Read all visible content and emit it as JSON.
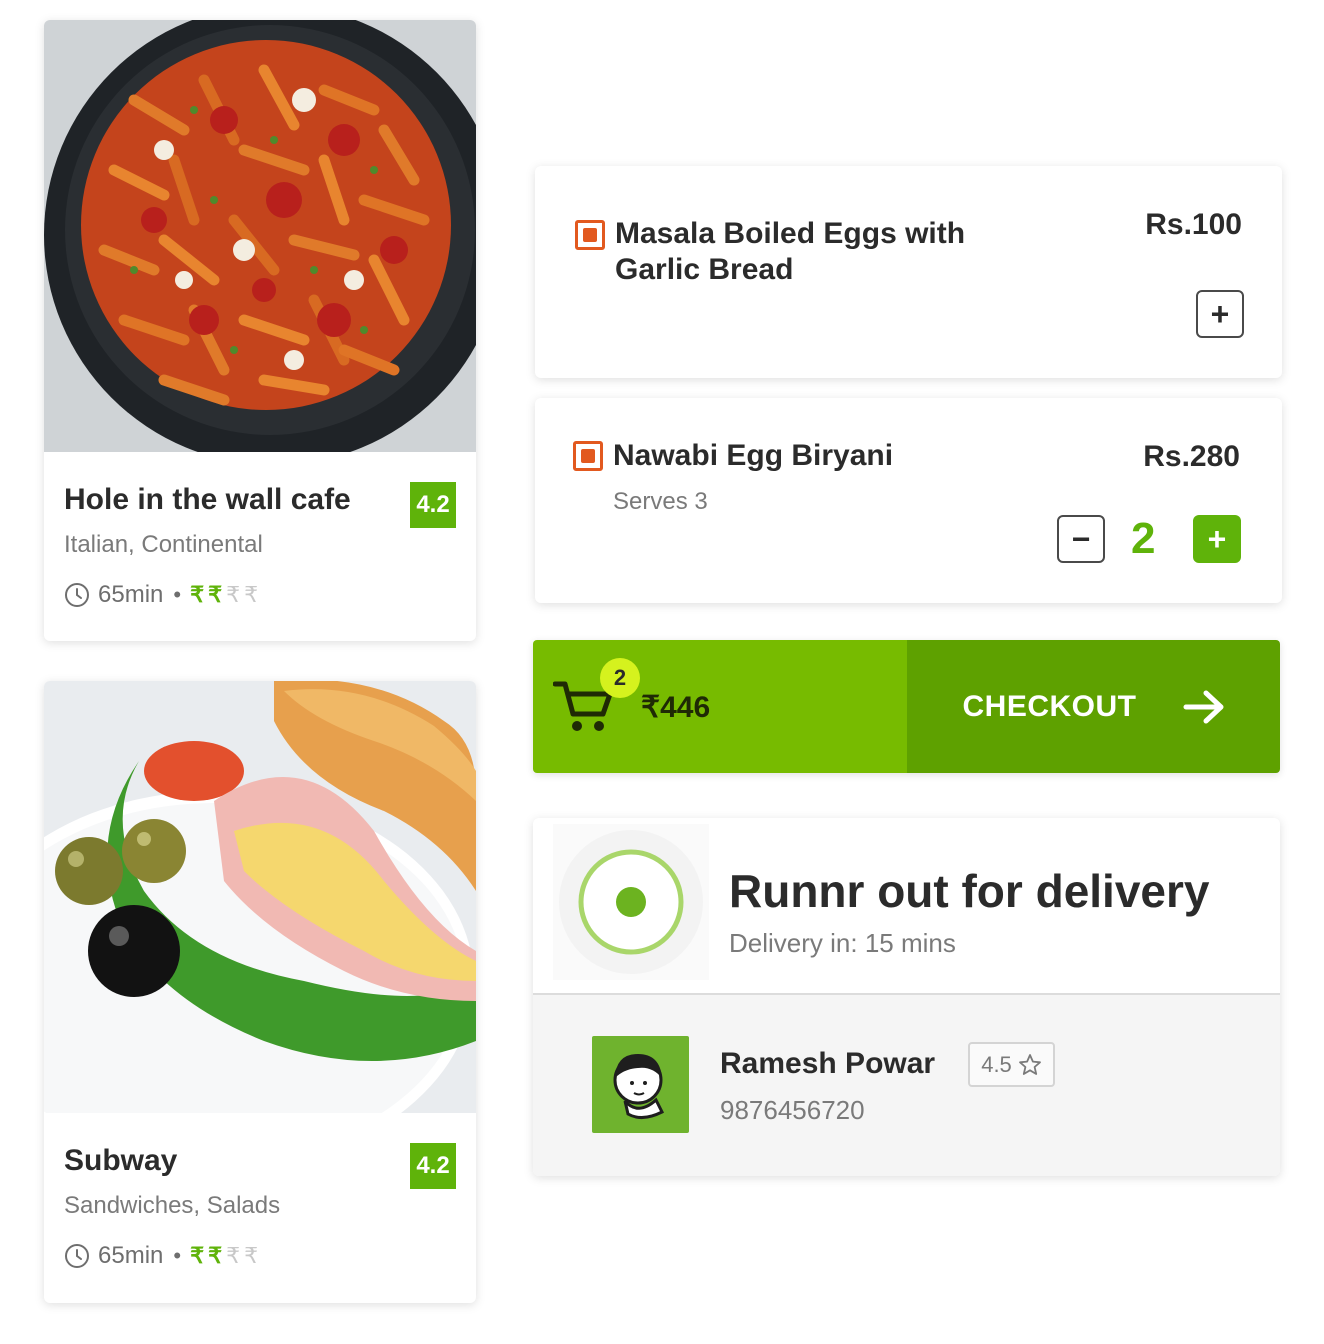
{
  "restaurants": [
    {
      "name": "Hole in the wall cafe",
      "cuisine": "Italian, Continental",
      "rating": "4.2",
      "time": "65min",
      "separator": "•",
      "price_level": [
        true,
        true,
        false,
        false
      ],
      "rupee_symbol": "₹",
      "photo": "pasta-photo"
    },
    {
      "name": "Subway",
      "cuisine": "Sandwiches, Salads",
      "rating": "4.2",
      "time": "65min",
      "separator": "•",
      "price_level": [
        true,
        true,
        false,
        false
      ],
      "rupee_symbol": "₹",
      "photo": "sandwich-photo"
    }
  ],
  "menu_items": [
    {
      "name": "Masala Boiled Eggs with Garlic Bread",
      "price": "Rs.100",
      "add_label": "+",
      "type_icon": "non-veg-icon"
    },
    {
      "name": "Nawabi Egg Biryani",
      "serves": "Serves 3",
      "price": "Rs.280",
      "quantity": "2",
      "minus_label": "−",
      "plus_label": "+",
      "type_icon": "non-veg-icon"
    }
  ],
  "cart": {
    "count": "2",
    "total": "₹446",
    "checkout_label": "CHECKOUT",
    "icon": "cart-icon",
    "arrow_icon": "arrow-right-icon"
  },
  "delivery": {
    "title": "Runnr out for delivery",
    "eta": "Delivery in: 15 mins",
    "runner": {
      "name": "Ramesh Powar",
      "phone": "9876456720",
      "rating": "4.5",
      "rating_icon": "star-icon"
    }
  },
  "colors": {
    "brand_green": "#5fb30a",
    "cart_light": "#77bb00",
    "cart_dark": "#5ea100",
    "badge_yellow": "#d5f21e",
    "nonveg_orange": "#e2591f"
  }
}
